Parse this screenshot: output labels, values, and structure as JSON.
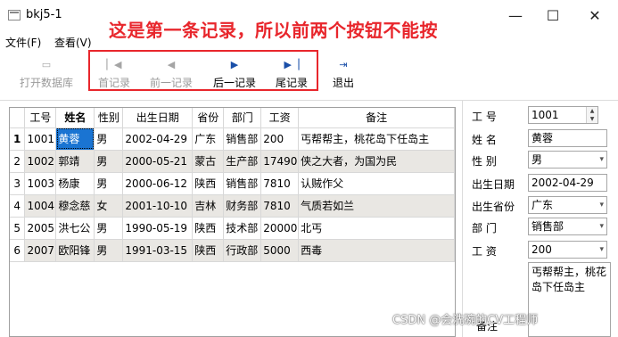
{
  "window": {
    "title": "bkj5-1",
    "minimize": "—",
    "maximize": "☐",
    "close": "✕"
  },
  "annotation": "这是第一条记录，所以前两个按钮不能按",
  "menu": [
    {
      "label": "文件(F)"
    },
    {
      "label": "查看(V)"
    }
  ],
  "toolbar": {
    "open_db": "打开数据库",
    "first": "首记录",
    "prev": "前一记录",
    "next": "后一记录",
    "last": "尾记录",
    "exit": "退出"
  },
  "table": {
    "columns": [
      "工号",
      "姓名",
      "性别",
      "出生日期",
      "省份",
      "部门",
      "工资",
      "备注"
    ],
    "rows": [
      {
        "num": "1",
        "cells": [
          "1001",
          "黄蓉",
          "男",
          "2002-04-29",
          "广东",
          "销售部",
          "200",
          "丐帮帮主，桃花岛下任岛主"
        ]
      },
      {
        "num": "2",
        "cells": [
          "1002",
          "郭靖",
          "男",
          "2000-05-21",
          "蒙古",
          "生产部",
          "17490",
          "侠之大者，为国为民"
        ]
      },
      {
        "num": "3",
        "cells": [
          "1003",
          "杨康",
          "男",
          "2000-06-12",
          "陕西",
          "销售部",
          "7810",
          "认贼作父"
        ]
      },
      {
        "num": "4",
        "cells": [
          "1004",
          "穆念慈",
          "女",
          "2001-10-10",
          "吉林",
          "财务部",
          "7810",
          "气质若如兰"
        ]
      },
      {
        "num": "5",
        "cells": [
          "2005",
          "洪七公",
          "男",
          "1990-05-19",
          "陕西",
          "技术部",
          "20000",
          "北丐"
        ]
      },
      {
        "num": "6",
        "cells": [
          "2007",
          "欧阳锋",
          "男",
          "1991-03-15",
          "陕西",
          "行政部",
          "5000",
          "西毒"
        ]
      }
    ]
  },
  "form": {
    "labels": {
      "id": "工    号",
      "name": "姓    名",
      "gender": "性    别",
      "birth": "出生日期",
      "province": "出生省份",
      "dept": "部    门",
      "salary": "工    资",
      "memo": "备注"
    },
    "values": {
      "id": "1001",
      "name": "黄蓉",
      "gender": "男",
      "birth": "2002-04-29",
      "province": "广东",
      "dept": "销售部",
      "salary": "200",
      "memo": "丐帮帮主，桃花岛下任岛主"
    }
  },
  "watermark": "CSDN @会洗碗的CV工程师"
}
